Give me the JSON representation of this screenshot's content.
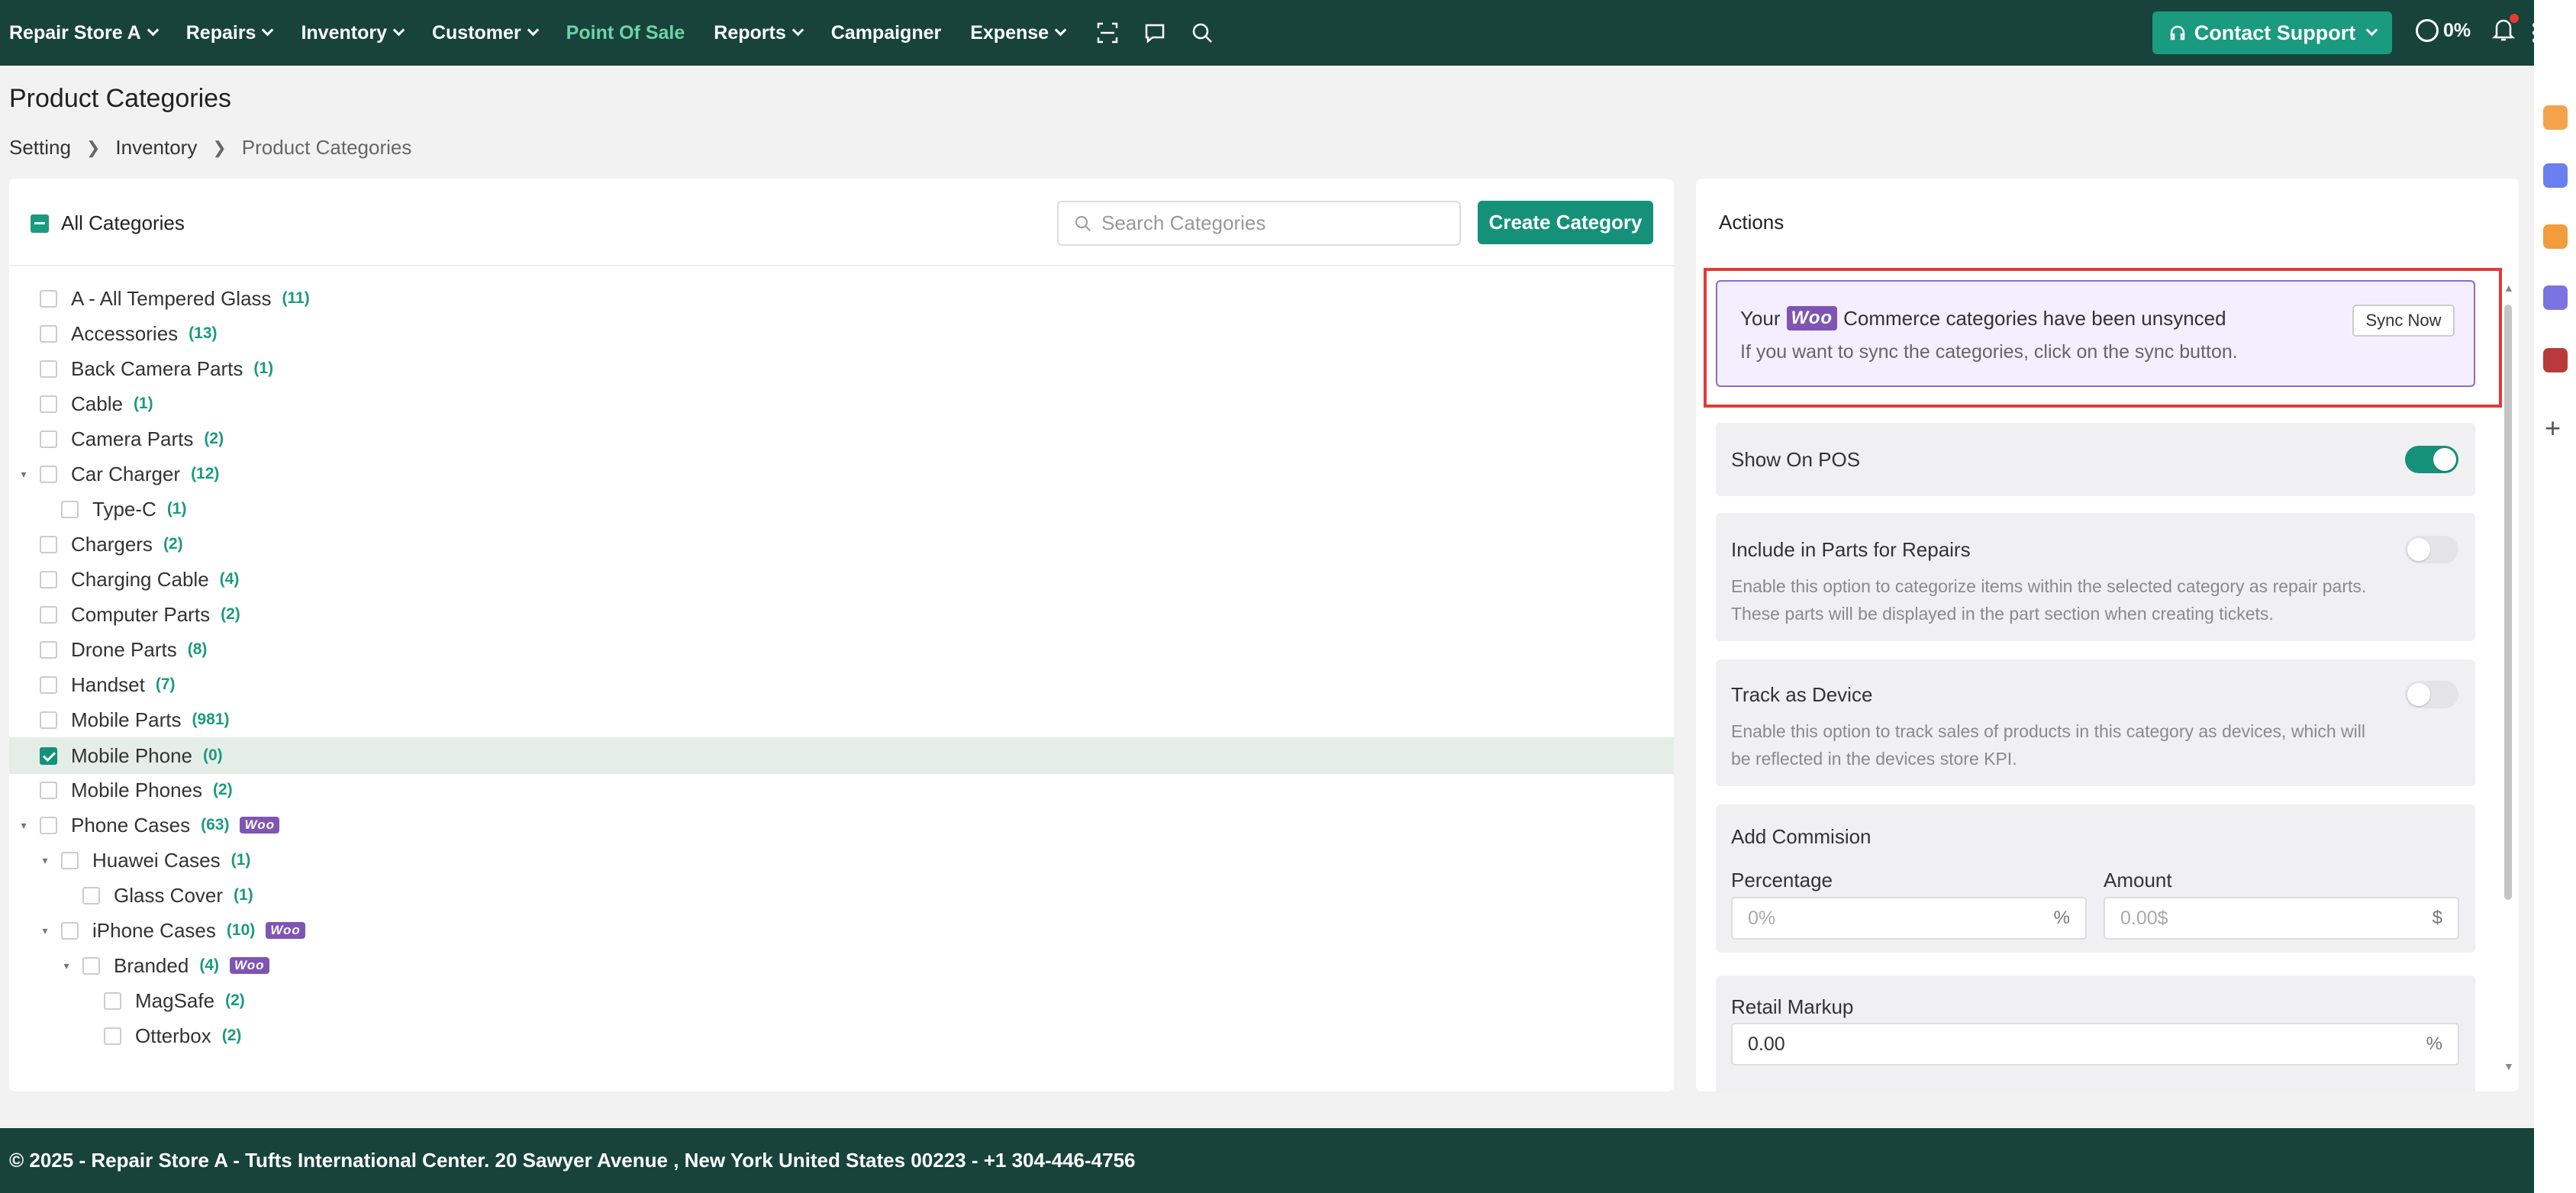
{
  "nav": {
    "store": "Repair Store A",
    "items": [
      "Repairs",
      "Inventory",
      "Customer",
      "Point Of Sale",
      "Reports",
      "Campaigner",
      "Expense"
    ],
    "support": "Contact Support",
    "progress": "0%"
  },
  "page": {
    "title": "Product Categories",
    "breadcrumb": [
      "Setting",
      "Inventory",
      "Product Categories"
    ]
  },
  "categories": {
    "all_label": "All Categories",
    "search_placeholder": "Search Categories",
    "create_label": "Create Category",
    "woo_badge": "Woo",
    "rows": [
      {
        "label": "A - All Tempered Glass",
        "count": "(11)"
      },
      {
        "label": "Accessories",
        "count": "(13)"
      },
      {
        "label": "Back Camera Parts",
        "count": "(1)"
      },
      {
        "label": "Cable",
        "count": "(1)"
      },
      {
        "label": "Camera Parts",
        "count": "(2)"
      },
      {
        "label": "Car Charger",
        "count": "(12)"
      },
      {
        "label": "Type-C",
        "count": "(1)"
      },
      {
        "label": "Chargers",
        "count": "(2)"
      },
      {
        "label": "Charging Cable",
        "count": "(4)"
      },
      {
        "label": "Computer Parts",
        "count": "(2)"
      },
      {
        "label": "Drone Parts",
        "count": "(8)"
      },
      {
        "label": "Handset",
        "count": "(7)"
      },
      {
        "label": "Mobile Parts",
        "count": "(981)"
      },
      {
        "label": "Mobile Phone",
        "count": "(0)"
      },
      {
        "label": "Mobile Phones",
        "count": "(2)"
      },
      {
        "label": "Phone Cases",
        "count": "(63)"
      },
      {
        "label": "Huawei Cases",
        "count": "(1)"
      },
      {
        "label": "Glass Cover",
        "count": "(1)"
      },
      {
        "label": "iPhone Cases",
        "count": "(10)"
      },
      {
        "label": "Branded",
        "count": "(4)"
      },
      {
        "label": "MagSafe",
        "count": "(2)"
      },
      {
        "label": "Otterbox",
        "count": "(2)"
      }
    ]
  },
  "actions": {
    "title": "Actions",
    "sync": {
      "prefix": "Your",
      "woo": "Woo",
      "suffix": "Commerce categories have been unsynced",
      "hint": "If you want to sync the categories, click on the sync button.",
      "button": "Sync Now"
    },
    "show_on_pos": {
      "label": "Show On POS",
      "on": true
    },
    "parts": {
      "label": "Include in Parts for Repairs",
      "desc": "Enable this option to categorize items within the selected category as repair parts. These parts will be displayed in the part section when creating tickets.",
      "on": false
    },
    "device": {
      "label": "Track as Device",
      "desc": "Enable this option to track sales of products in this category as devices, which will be reflected in the devices store KPI.",
      "on": false
    },
    "commission": {
      "title": "Add Commision",
      "percentage_label": "Percentage",
      "percentage_placeholder": "0%",
      "percentage_suffix": "%",
      "amount_label": "Amount",
      "amount_placeholder": "0.00$",
      "amount_suffix": "$"
    },
    "markup": {
      "label": "Retail Markup",
      "value": "0.00",
      "suffix": "%"
    }
  },
  "footer": "© 2025 - Repair Store A - Tufts International Center. 20 Sawyer Avenue , New York United States 00223 - +1 304-446-4756",
  "colors": {
    "topbar": "#17433b",
    "accent": "#15917a",
    "woo": "#7f54b3",
    "highlight": "#e53935"
  }
}
